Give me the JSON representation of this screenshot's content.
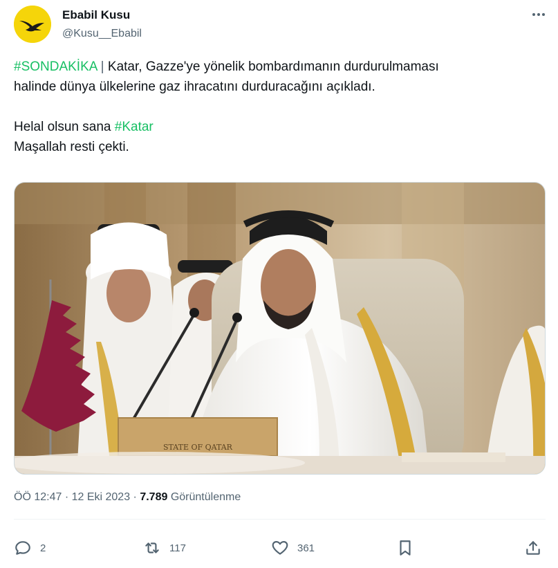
{
  "author": {
    "display_name": "Ebabil Kusu",
    "handle": "@Kusu__Ebabil",
    "avatar_color": "#f5d50a"
  },
  "tweet": {
    "line1_hashtag": "#SONDAKİKA",
    "line1_sep": " | ",
    "line1_rest": "Katar, Gazze'ye yönelik bombardımanın durdurulmaması",
    "line2": "halinde dünya ülkelerine gaz ihracatını durduracağını açıkladı.",
    "line3_text": "Helal olsun sana ",
    "line3_hashtag": "#Katar",
    "line4": "Maşallah resti çekti.",
    "hashtag_color": "#17bf63"
  },
  "media": {
    "placard_text": "STATE OF QATAR"
  },
  "meta": {
    "time": "ÖÖ 12:47",
    "dot1": " · ",
    "date": "12 Eki 2023",
    "dot2": " · ",
    "views_count": "7.789",
    "views_label": " Görüntülenme"
  },
  "actions": {
    "reply_count": "2",
    "retweet_count": "117",
    "like_count": "361"
  },
  "icons": [
    "more-icon",
    "reply-icon",
    "retweet-icon",
    "like-icon",
    "bookmark-icon",
    "share-icon"
  ]
}
